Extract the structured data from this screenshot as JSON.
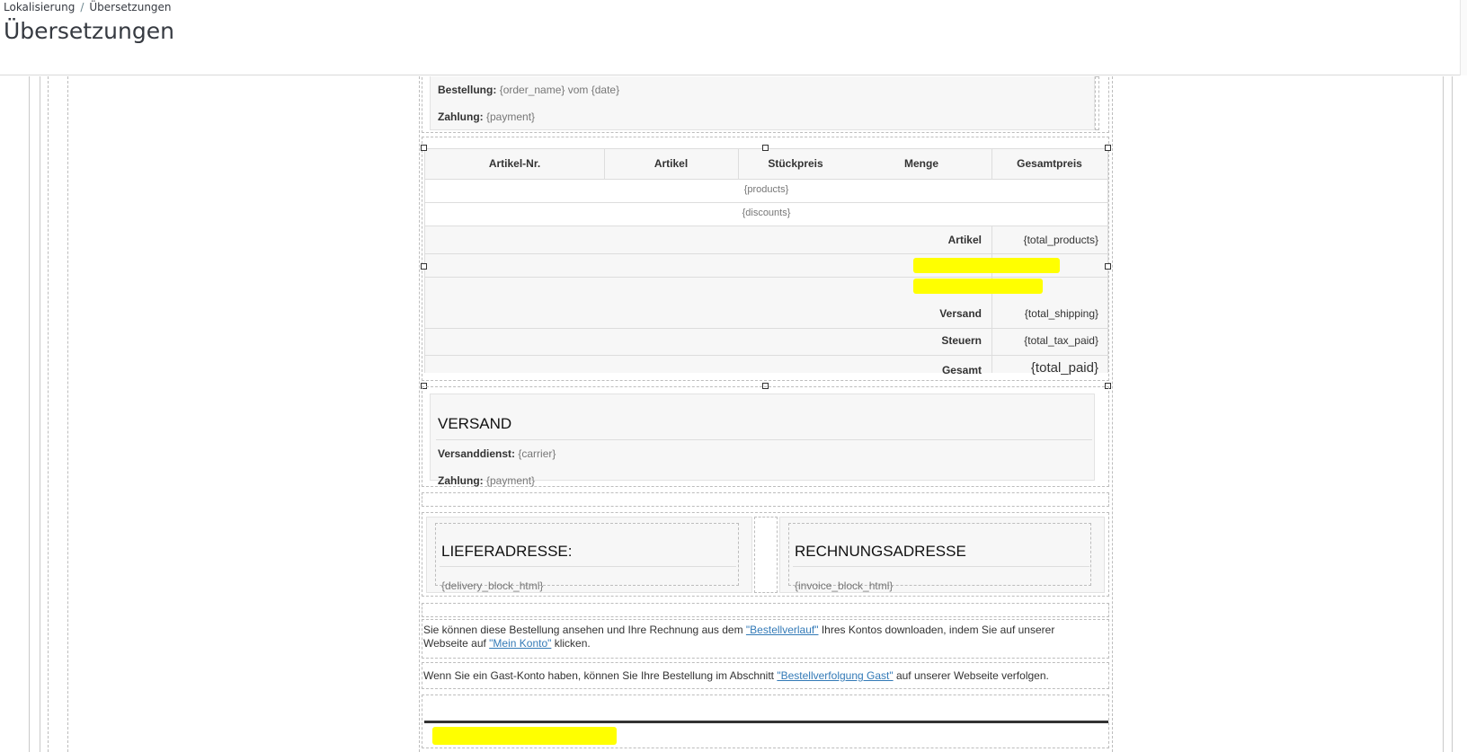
{
  "breadcrumb": {
    "parent": "Lokalisierung",
    "separator": "/",
    "current": "Übersetzungen"
  },
  "page_title": "Übersetzungen",
  "order_block": {
    "order_label": "Bestellung:",
    "order_value": "{order_name} vom {date}",
    "payment_label": "Zahlung:",
    "payment_value": "{payment}"
  },
  "product_table": {
    "headers": [
      "Artikel-Nr.",
      "Artikel",
      "Stückpreis",
      "Menge",
      "Gesamtpreis"
    ],
    "products_placeholder": "{products}",
    "discounts_placeholder": "{discounts}",
    "totals": [
      {
        "label": "Artikel",
        "value": "{total_products}"
      },
      {
        "label": "Versand",
        "value": "{total_shipping}"
      },
      {
        "label": "Steuern",
        "value": "{total_tax_paid}"
      },
      {
        "label": "Gesamt",
        "value": "{total_paid}"
      }
    ]
  },
  "shipping_block": {
    "title": "VERSAND",
    "carrier_label": "Versanddienst:",
    "carrier_value": "{carrier}",
    "payment_label": "Zahlung:",
    "payment_value": "{payment}"
  },
  "addresses": {
    "delivery_title": "LIEFERADRESSE:",
    "delivery_value": "{delivery_block_html}",
    "invoice_title": "RECHNUNGSADRESSE",
    "invoice_value": "{invoice_block_html}"
  },
  "info_texts": {
    "history_part1": "Sie können diese Bestellung ansehen und Ihre Rechnung aus dem ",
    "history_link": "\"Bestellverlauf\"",
    "history_part2": " Ihres Kontos downloaden, indem Sie auf unserer",
    "history_part3": "Webseite auf ",
    "account_link": "\"Mein Konto\"",
    "history_part4": " klicken.",
    "guest_part1": "Wenn Sie ein Gast-Konto haben, können Sie Ihre Bestellung im Abschnitt ",
    "guest_link": "\"Bestellverfolgung Gast\"",
    "guest_part2": " auf unserer Webseite verfolgen."
  },
  "colors": {
    "highlight": "#ffff00",
    "link": "#337ab7",
    "panel": "#f7f7f7"
  }
}
